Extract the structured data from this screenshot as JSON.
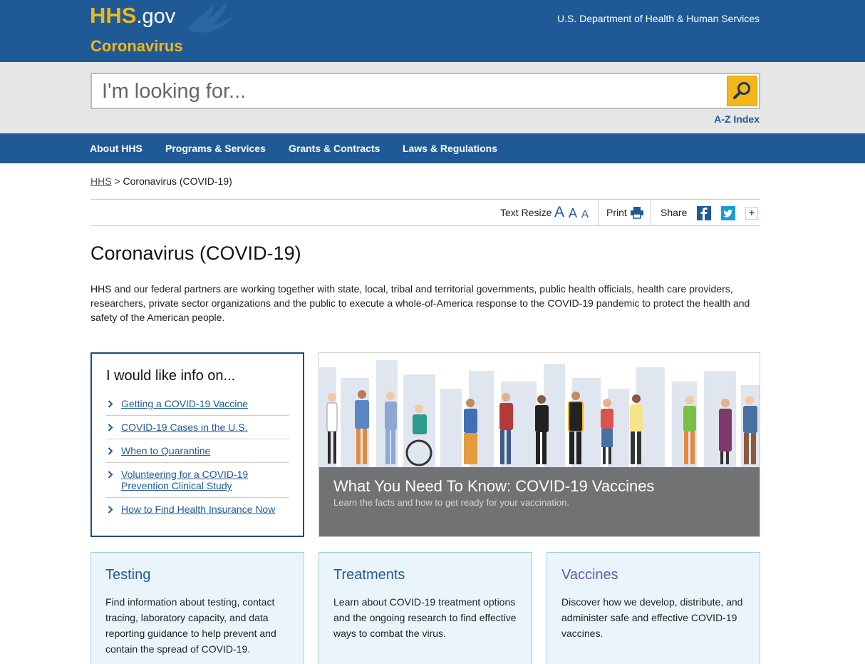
{
  "header": {
    "logo_main": "HHS",
    "logo_suffix": ".gov",
    "subsite": "Coronavirus",
    "department": "U.S. Department of Health & Human Services"
  },
  "search": {
    "placeholder": "I'm looking for...",
    "value": "",
    "az_index": "A-Z Index"
  },
  "nav": {
    "items": [
      "About HHS",
      "Programs & Services",
      "Grants & Contracts",
      "Laws & Regulations"
    ]
  },
  "breadcrumb": {
    "home": "HHS",
    "separator": ">",
    "current": "Coronavirus (COVID-19)"
  },
  "tools": {
    "text_resize": "Text Resize",
    "resize_letter": "A",
    "print": "Print",
    "share": "Share",
    "more": "+"
  },
  "page": {
    "title": "Coronavirus (COVID-19)",
    "intro": "HHS and our federal partners are working together with state, local, tribal and territorial governments, public health officials, health care providers, researchers, private sector organizations and the public to execute a whole-of-America response to the COVID-19 pandemic to protect the health and safety of the American people."
  },
  "info_box": {
    "title": "I would like info on...",
    "links": [
      "Getting a COVID-19 Vaccine",
      "COVID-19 Cases in the U.S.",
      "When to Quarantine",
      "Volunteering for a COVID-19 Prevention Clinical Study",
      "How to Find Health Insurance Now"
    ]
  },
  "hero": {
    "title": "What You Need To Know: COVID-19 Vaccines",
    "subtitle": "Learn the facts and how to get ready for your vaccination."
  },
  "cards": [
    {
      "title": "Testing",
      "body": "Find information about testing, contact tracing, laboratory capacity, and data reporting guidance to help prevent and contain the spread of COVID-19."
    },
    {
      "title": "Treatments",
      "body": "Learn about COVID-19 treatment options and the ongoing research to find effective ways to combat the virus."
    },
    {
      "title": "Vaccines",
      "body": "Discover how we develop, distribute, and administer safe and effective COVID-19 vaccines."
    }
  ],
  "icons": {
    "search": "search-icon",
    "print": "printer-icon",
    "facebook": "facebook-icon",
    "twitter": "twitter-icon",
    "chevron": "chevron-right-icon",
    "eagle": "hhs-eagle-icon"
  },
  "colors": {
    "brand_blue": "#1f5a96",
    "accent_gold": "#f3b618",
    "card_bg": "#eaf5fb",
    "vaccines_title": "#6b5aa6",
    "hero_band": "#707274"
  }
}
